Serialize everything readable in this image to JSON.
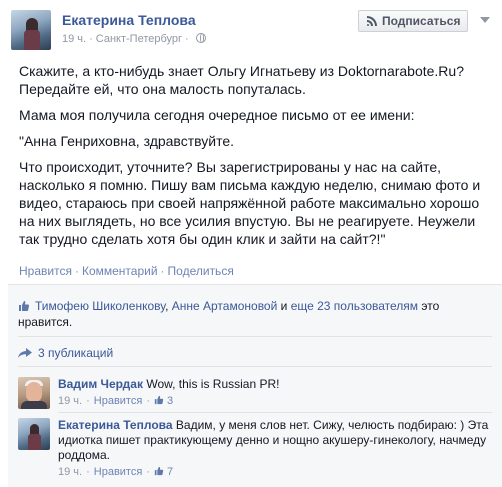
{
  "post": {
    "author": "Екатерина Теплова",
    "time": "19 ч.",
    "location": "Санкт-Петербург",
    "subscribe_label": "Подписаться",
    "paragraphs": [
      "Скажите, а кто-нибудь знает Ольгу Игнатьеву из Doktornarabote.Ru? Передайте ей, что она малость попуталась.",
      "Мама моя получила сегодня очередное письмо от ее имени:",
      "\"Анна Генриховна, здравствуйте.",
      "Что происходит, уточните? Вы зарегистрированы у нас на сайте, насколько я помню. Пишу вам письма каждую неделю, снимаю фото и видео, стараюсь при своей напряжённой работе максимально хорошо на них выглядеть, но все усилия впустую. Вы не реагируете. Неужели так трудно сделать хотя бы один клик и зайти на сайт?!\""
    ],
    "actions": {
      "like": "Нравится",
      "comment": "Комментарий",
      "share": "Поделиться"
    }
  },
  "likes": {
    "name1": "Тимофею Шиколенкову",
    "name2": "Анне Артамоновой",
    "and": "и",
    "more": "еще 23 пользователям",
    "suffix": "это нравится."
  },
  "shares": {
    "label": "3 публикаций"
  },
  "comments": [
    {
      "author": "Вадим Чердак",
      "text": "Wow, this is Russian PR!",
      "time": "19 ч.",
      "like": "Нравится",
      "likes_count": "3"
    },
    {
      "author": "Екатерина Теплова",
      "text": "Вадим, у меня слов нет. Сижу, челюсть подбираю: ) Эта идиотка пишет практикующему денно и нощно акушеру-гинекологу, начмеду роддома.",
      "time": "19 ч.",
      "like": "Нравится",
      "likes_count": "7"
    }
  ],
  "colors": {
    "link": "#3b5998",
    "muted": "#9197a3",
    "feedback_bg": "#f6f7f8"
  }
}
